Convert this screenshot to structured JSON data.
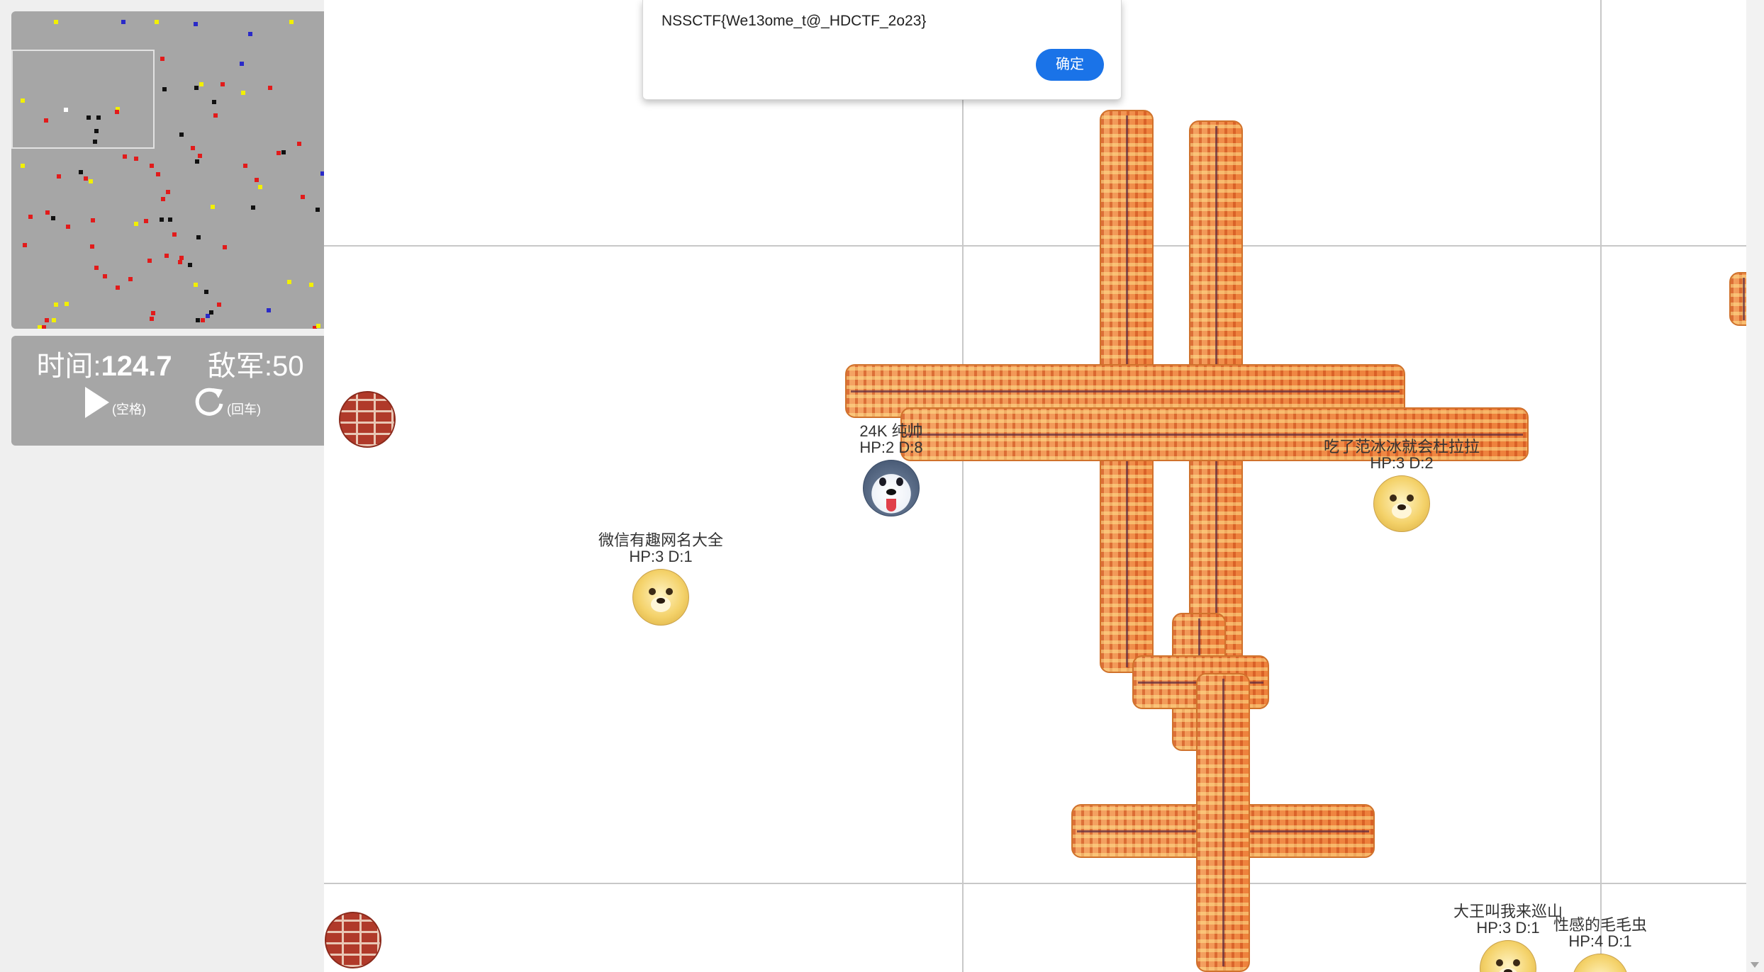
{
  "hud": {
    "time_label": "时间:",
    "time_value": "124.7",
    "enemy_label": "敌军:",
    "enemy_value": "50",
    "play_key": "(空格)",
    "restart_key": "(回车)"
  },
  "dialog": {
    "message": "NSSCTF{We13ome_t@_HDCTF_2o23}",
    "ok_label": "确定"
  },
  "players": [
    {
      "name": "24K 纯帅",
      "stats": "HP:2 D:8",
      "avatar": "husky-avatar"
    },
    {
      "name": "吃了范冰冰就会杜拉拉",
      "stats": "HP:3 D:2",
      "avatar": "doge-avatar"
    },
    {
      "name": "微信有趣网名大全",
      "stats": "HP:3 D:1",
      "avatar": "doge-avatar"
    },
    {
      "name": "大王叫我来巡山",
      "stats": "HP:3 D:1",
      "avatar": "doge-avatar"
    },
    {
      "name": "性感的毛毛虫",
      "stats": "HP:4 D:1",
      "avatar": "doge-avatar"
    }
  ],
  "icons": {
    "play": "play-icon",
    "restart": "restart-icon",
    "brick": "brick-wall-icon",
    "fire": "fire-explosion"
  },
  "colors": {
    "minimap_bg": "#a6a6a6",
    "dot_red": "#e21b1b",
    "dot_black": "#111111",
    "dot_yellow": "#f2f000",
    "dot_blue": "#2a2ac8",
    "dot_white": "#ffffff",
    "ok_button": "#1a73e8"
  }
}
